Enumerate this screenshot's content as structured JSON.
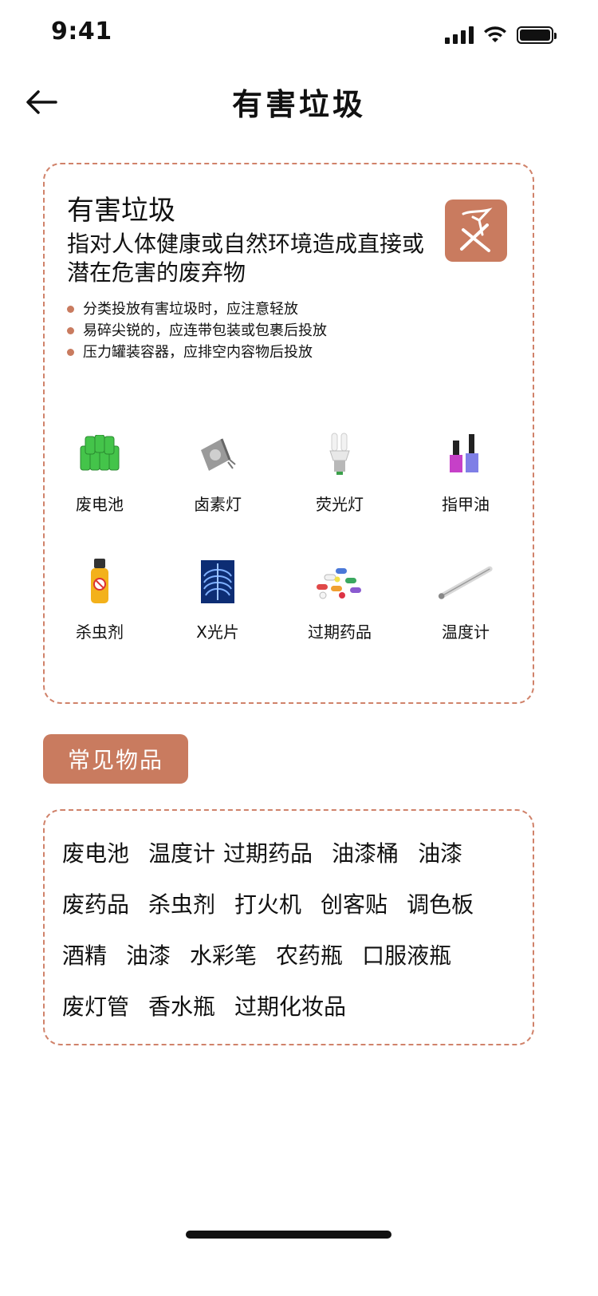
{
  "status_bar": {
    "time": "9:41"
  },
  "header": {
    "title": "有害垃圾",
    "back_icon": "arrow-left-icon"
  },
  "info_card": {
    "heading": "有害垃圾",
    "description": "指对人体健康或自然环境造成直接或潜在危害的废弃物",
    "badge_icon": "hazardous-waste-icon",
    "accent_color": "#c97b5f",
    "tips": [
      "分类投放有害垃圾时，应注意轻放",
      "易碎尖锐的，应连带包装或包裹后投放",
      "压力罐装容器，应排空内容物后投放"
    ],
    "items": [
      {
        "label": "废电池",
        "icon": "battery-pack-icon"
      },
      {
        "label": "卤素灯",
        "icon": "halogen-lamp-icon"
      },
      {
        "label": "荧光灯",
        "icon": "fluorescent-bulb-icon"
      },
      {
        "label": "指甲油",
        "icon": "nail-polish-icon"
      },
      {
        "label": "杀虫剂",
        "icon": "insecticide-spray-icon"
      },
      {
        "label": "X光片",
        "icon": "xray-film-icon"
      },
      {
        "label": "过期药品",
        "icon": "pills-icon"
      },
      {
        "label": "温度计",
        "icon": "thermometer-icon"
      }
    ]
  },
  "section_tag": "常见物品",
  "common_items": [
    [
      "废电池",
      "温度计",
      "过期药品",
      "油漆桶",
      "油漆"
    ],
    [
      "废药品",
      "杀虫剂",
      "打火机",
      "创客贴",
      "调色板"
    ],
    [
      "酒精",
      "油漆",
      "水彩笔",
      "农药瓶",
      "口服液瓶"
    ],
    [
      "废灯管",
      "香水瓶",
      "过期化妆品"
    ]
  ]
}
